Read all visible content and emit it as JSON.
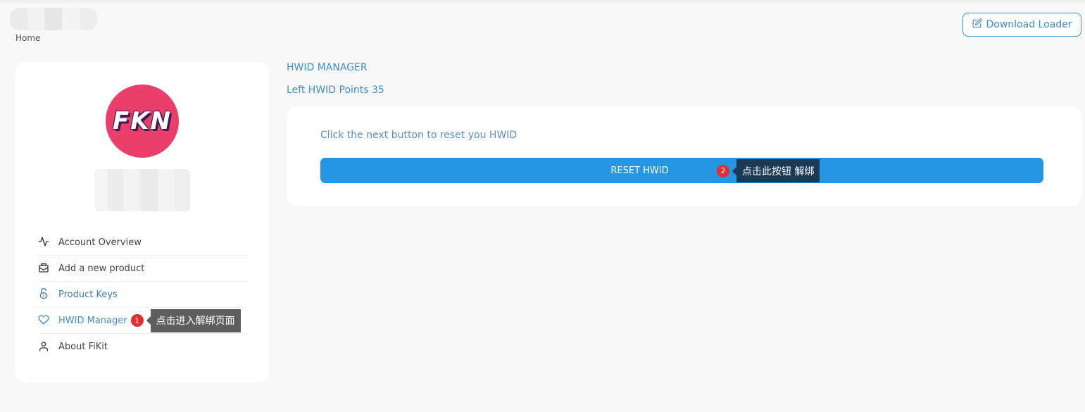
{
  "header": {
    "breadcrumb": "Home",
    "download_label": "Download Loader"
  },
  "sidebar": {
    "avatar_text": "FKN",
    "items": [
      {
        "label": "Account Overview",
        "icon": "activity-icon"
      },
      {
        "label": "Add a new product",
        "icon": "package-icon"
      },
      {
        "label": "Product Keys",
        "icon": "unlock-icon"
      },
      {
        "label": "HWID Manager",
        "icon": "heart-icon"
      },
      {
        "label": "About FiKit",
        "icon": "user-icon"
      }
    ],
    "annotation": {
      "badge": "1",
      "text": "点击进入解绑页面"
    }
  },
  "main": {
    "heading": "HWID MANAGER",
    "points": "Left HWID Points 35",
    "instruction": "Click the next button to reset you HWID",
    "reset_label": "RESET HWID",
    "annotation": {
      "badge": "2",
      "text": "点击此按钮 解绑"
    }
  },
  "colors": {
    "accent": "#3c8fd0",
    "button": "#2496e3",
    "avatar": "#ec3e6a",
    "badge": "#e62d2d"
  }
}
